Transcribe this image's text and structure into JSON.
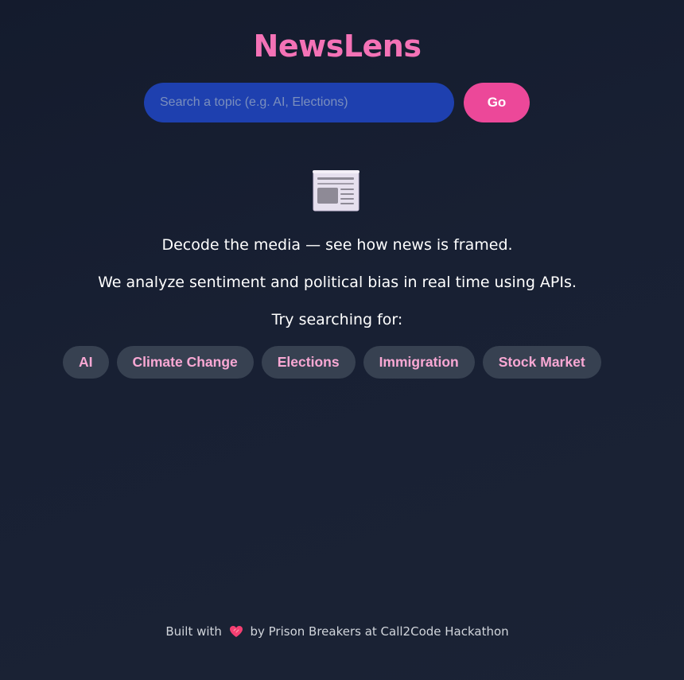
{
  "app": {
    "title": "NewsLens"
  },
  "search": {
    "placeholder": "Search a topic (e.g. AI, Elections)",
    "value": "",
    "button_label": "Go"
  },
  "hero": {
    "icon": "newspaper-icon",
    "line1": "Decode the media — see how news is framed.",
    "line2": "We analyze sentiment and political bias in real time using APIs.",
    "line3": "Try searching for:"
  },
  "suggestions": [
    "AI",
    "Climate Change",
    "Elections",
    "Immigration",
    "Stock Market"
  ],
  "footer": {
    "prefix": "Built with",
    "icon": "heart-icon",
    "suffix": "by Prison Breakers at Call2Code Hackathon"
  },
  "colors": {
    "background": "#161d2f",
    "accent": "#ec4899",
    "title": "#f472b6",
    "search_bg": "#1e40af",
    "chip_bg": "#374151",
    "chip_text": "#f9a8d4"
  }
}
